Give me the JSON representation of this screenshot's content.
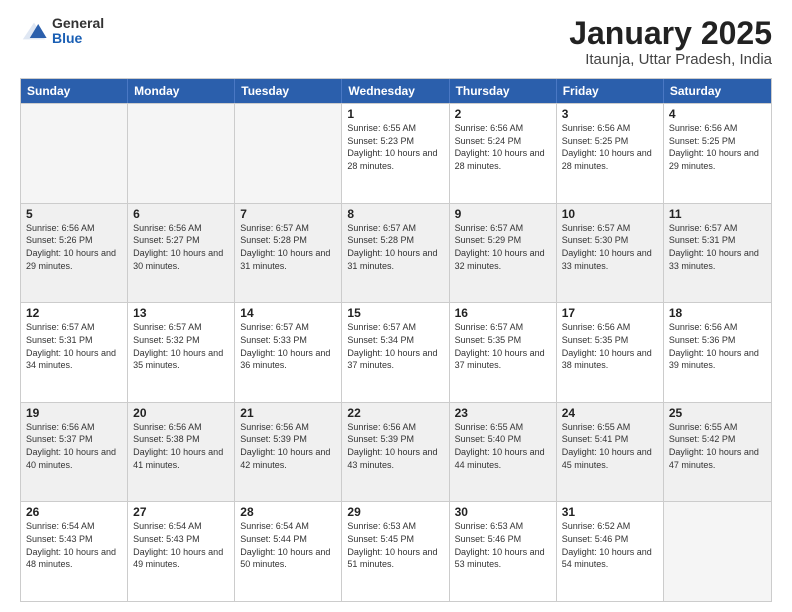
{
  "header": {
    "logo": {
      "general": "General",
      "blue": "Blue"
    },
    "title": "January 2025",
    "subtitle": "Itaunja, Uttar Pradesh, India"
  },
  "days_of_week": [
    "Sunday",
    "Monday",
    "Tuesday",
    "Wednesday",
    "Thursday",
    "Friday",
    "Saturday"
  ],
  "weeks": [
    [
      {
        "day": "",
        "empty": true
      },
      {
        "day": "",
        "empty": true
      },
      {
        "day": "",
        "empty": true
      },
      {
        "day": "1",
        "sunrise": "6:55 AM",
        "sunset": "5:23 PM",
        "daylight": "10 hours and 28 minutes."
      },
      {
        "day": "2",
        "sunrise": "6:56 AM",
        "sunset": "5:24 PM",
        "daylight": "10 hours and 28 minutes."
      },
      {
        "day": "3",
        "sunrise": "6:56 AM",
        "sunset": "5:25 PM",
        "daylight": "10 hours and 28 minutes."
      },
      {
        "day": "4",
        "sunrise": "6:56 AM",
        "sunset": "5:25 PM",
        "daylight": "10 hours and 29 minutes."
      }
    ],
    [
      {
        "day": "5",
        "sunrise": "6:56 AM",
        "sunset": "5:26 PM",
        "daylight": "10 hours and 29 minutes."
      },
      {
        "day": "6",
        "sunrise": "6:56 AM",
        "sunset": "5:27 PM",
        "daylight": "10 hours and 30 minutes."
      },
      {
        "day": "7",
        "sunrise": "6:57 AM",
        "sunset": "5:28 PM",
        "daylight": "10 hours and 31 minutes."
      },
      {
        "day": "8",
        "sunrise": "6:57 AM",
        "sunset": "5:28 PM",
        "daylight": "10 hours and 31 minutes."
      },
      {
        "day": "9",
        "sunrise": "6:57 AM",
        "sunset": "5:29 PM",
        "daylight": "10 hours and 32 minutes."
      },
      {
        "day": "10",
        "sunrise": "6:57 AM",
        "sunset": "5:30 PM",
        "daylight": "10 hours and 33 minutes."
      },
      {
        "day": "11",
        "sunrise": "6:57 AM",
        "sunset": "5:31 PM",
        "daylight": "10 hours and 33 minutes."
      }
    ],
    [
      {
        "day": "12",
        "sunrise": "6:57 AM",
        "sunset": "5:31 PM",
        "daylight": "10 hours and 34 minutes."
      },
      {
        "day": "13",
        "sunrise": "6:57 AM",
        "sunset": "5:32 PM",
        "daylight": "10 hours and 35 minutes."
      },
      {
        "day": "14",
        "sunrise": "6:57 AM",
        "sunset": "5:33 PM",
        "daylight": "10 hours and 36 minutes."
      },
      {
        "day": "15",
        "sunrise": "6:57 AM",
        "sunset": "5:34 PM",
        "daylight": "10 hours and 37 minutes."
      },
      {
        "day": "16",
        "sunrise": "6:57 AM",
        "sunset": "5:35 PM",
        "daylight": "10 hours and 37 minutes."
      },
      {
        "day": "17",
        "sunrise": "6:56 AM",
        "sunset": "5:35 PM",
        "daylight": "10 hours and 38 minutes."
      },
      {
        "day": "18",
        "sunrise": "6:56 AM",
        "sunset": "5:36 PM",
        "daylight": "10 hours and 39 minutes."
      }
    ],
    [
      {
        "day": "19",
        "sunrise": "6:56 AM",
        "sunset": "5:37 PM",
        "daylight": "10 hours and 40 minutes."
      },
      {
        "day": "20",
        "sunrise": "6:56 AM",
        "sunset": "5:38 PM",
        "daylight": "10 hours and 41 minutes."
      },
      {
        "day": "21",
        "sunrise": "6:56 AM",
        "sunset": "5:39 PM",
        "daylight": "10 hours and 42 minutes."
      },
      {
        "day": "22",
        "sunrise": "6:56 AM",
        "sunset": "5:39 PM",
        "daylight": "10 hours and 43 minutes."
      },
      {
        "day": "23",
        "sunrise": "6:55 AM",
        "sunset": "5:40 PM",
        "daylight": "10 hours and 44 minutes."
      },
      {
        "day": "24",
        "sunrise": "6:55 AM",
        "sunset": "5:41 PM",
        "daylight": "10 hours and 45 minutes."
      },
      {
        "day": "25",
        "sunrise": "6:55 AM",
        "sunset": "5:42 PM",
        "daylight": "10 hours and 47 minutes."
      }
    ],
    [
      {
        "day": "26",
        "sunrise": "6:54 AM",
        "sunset": "5:43 PM",
        "daylight": "10 hours and 48 minutes."
      },
      {
        "day": "27",
        "sunrise": "6:54 AM",
        "sunset": "5:43 PM",
        "daylight": "10 hours and 49 minutes."
      },
      {
        "day": "28",
        "sunrise": "6:54 AM",
        "sunset": "5:44 PM",
        "daylight": "10 hours and 50 minutes."
      },
      {
        "day": "29",
        "sunrise": "6:53 AM",
        "sunset": "5:45 PM",
        "daylight": "10 hours and 51 minutes."
      },
      {
        "day": "30",
        "sunrise": "6:53 AM",
        "sunset": "5:46 PM",
        "daylight": "10 hours and 53 minutes."
      },
      {
        "day": "31",
        "sunrise": "6:52 AM",
        "sunset": "5:46 PM",
        "daylight": "10 hours and 54 minutes."
      },
      {
        "day": "",
        "empty": true
      }
    ]
  ]
}
